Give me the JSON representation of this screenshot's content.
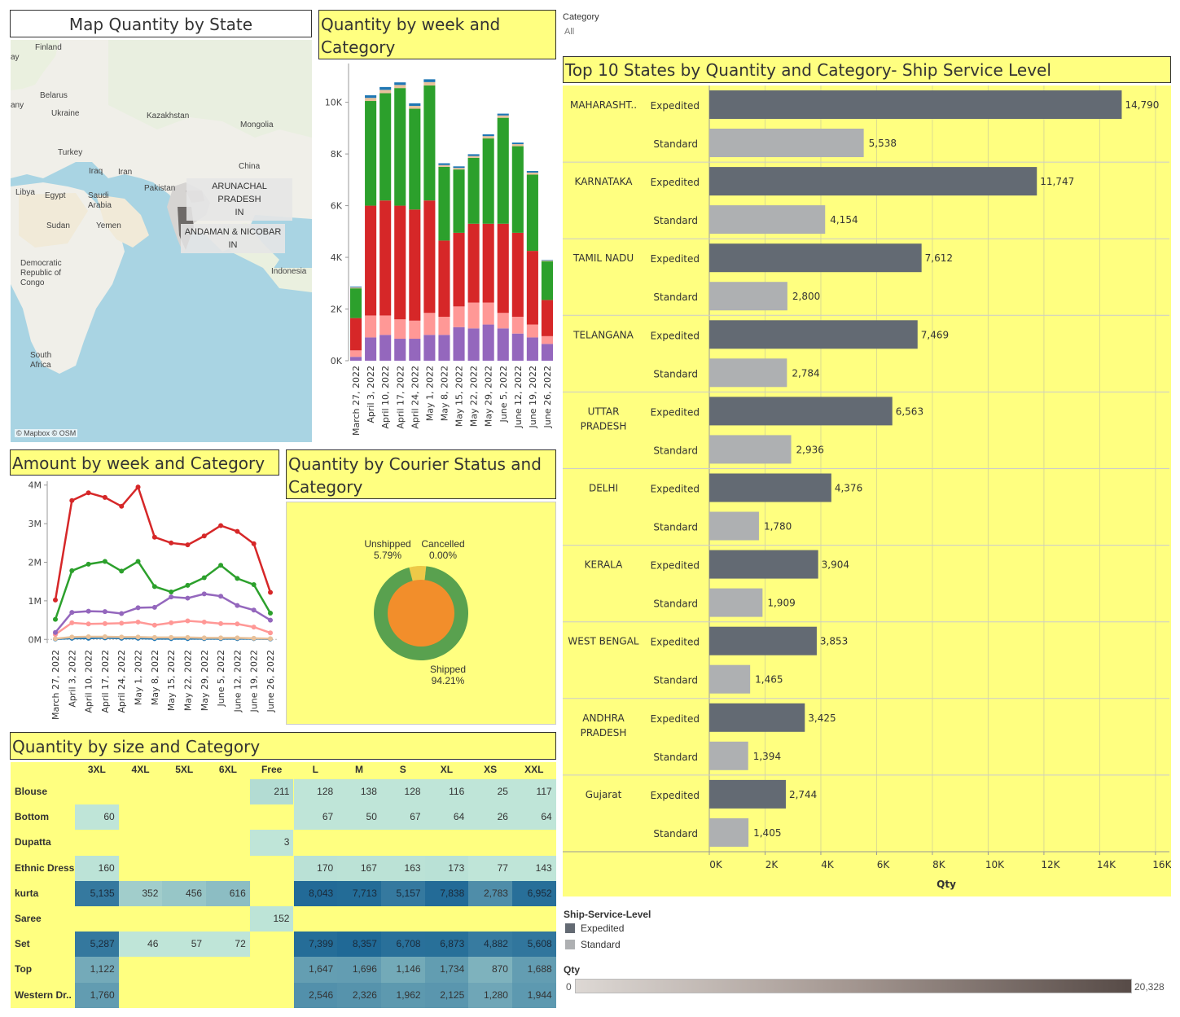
{
  "filter": {
    "label": "Category",
    "value": "All"
  },
  "map": {
    "title": "Map Quantity by State",
    "attribution": "© Mapbox © OSM",
    "labels": [
      "Finland",
      "Belarus",
      "Ukraine",
      "Kazakhstan",
      "Mongolia",
      "Turkey",
      "Iraq",
      "Iran",
      "China",
      "Libya",
      "Egypt",
      "Saudi Arabia",
      "Pakistan",
      "Sudan",
      "Yemen",
      "Indonesia",
      "Democratic Republic of Congo",
      "South Africa",
      "ay",
      "any"
    ],
    "tooltips": [
      {
        "line1": "ARUNACHAL PRADESH",
        "line2": "IN"
      },
      {
        "line1": "ANDAMAN & NICOBAR",
        "line2": "IN"
      }
    ]
  },
  "week_chart": {
    "title": "Quantity by week and Category",
    "weeks": [
      "March 27, 2022",
      "April 3, 2022",
      "April 10, 2022",
      "April 17, 2022",
      "April 24, 2022",
      "May 1, 2022",
      "May 8, 2022",
      "May 15, 2022",
      "May 22, 2022",
      "May 29, 2022",
      "June 5, 2022",
      "June 12, 2022",
      "June 19, 2022",
      "June 26, 2022"
    ],
    "y_ticks": [
      "0K",
      "2K",
      "4K",
      "6K",
      "8K",
      "10K"
    ]
  },
  "amount_chart": {
    "title": "Amount by week and Category",
    "y_ticks": [
      "0M",
      "1M",
      "2M",
      "3M",
      "4M"
    ]
  },
  "courier_chart": {
    "title": "Quantity by Courier Status and Category",
    "slices": [
      {
        "label": "Shipped",
        "pct": "94.21%",
        "value": 94.21,
        "color": "#59a14f"
      },
      {
        "label": "Unshipped",
        "pct": "5.79%",
        "value": 5.79,
        "color": "#edc948"
      },
      {
        "label": "Cancelled",
        "pct": "0.00%",
        "value": 0.0,
        "color": "#e15759"
      }
    ]
  },
  "size_table": {
    "title": "Quantity by size and Category",
    "columns": [
      "3XL",
      "4XL",
      "5XL",
      "6XL",
      "Free",
      "L",
      "M",
      "S",
      "XL",
      "XS",
      "XXL"
    ],
    "rows": [
      {
        "name": "Blouse",
        "cells": [
          "",
          "",
          "",
          "",
          "211",
          "128",
          "138",
          "128",
          "116",
          "25",
          "117"
        ]
      },
      {
        "name": "Bottom",
        "cells": [
          "60",
          "",
          "",
          "",
          "",
          "67",
          "50",
          "67",
          "64",
          "26",
          "64"
        ]
      },
      {
        "name": "Dupatta",
        "cells": [
          "",
          "",
          "",
          "",
          "3",
          "",
          "",
          "",
          "",
          "",
          ""
        ]
      },
      {
        "name": "Ethnic Dress",
        "cells": [
          "160",
          "",
          "",
          "",
          "",
          "170",
          "167",
          "163",
          "173",
          "77",
          "143"
        ]
      },
      {
        "name": "kurta",
        "cells": [
          "5,135",
          "352",
          "456",
          "616",
          "",
          "8,043",
          "7,713",
          "5,157",
          "7,838",
          "2,783",
          "6,952"
        ]
      },
      {
        "name": "Saree",
        "cells": [
          "",
          "",
          "",
          "",
          "152",
          "",
          "",
          "",
          "",
          "",
          ""
        ]
      },
      {
        "name": "Set",
        "cells": [
          "5,287",
          "46",
          "57",
          "72",
          "",
          "7,399",
          "8,357",
          "6,708",
          "6,873",
          "4,882",
          "5,608"
        ]
      },
      {
        "name": "Top",
        "cells": [
          "1,122",
          "",
          "",
          "",
          "",
          "1,647",
          "1,696",
          "1,146",
          "1,734",
          "870",
          "1,688"
        ]
      },
      {
        "name": "Western Dr..",
        "cells": [
          "1,760",
          "",
          "",
          "",
          "",
          "2,546",
          "2,326",
          "1,962",
          "2,125",
          "1,280",
          "1,944"
        ]
      }
    ]
  },
  "top_states": {
    "title": "Top 10 States by Quantity and Category- Ship Service Level",
    "x_label": "Qty",
    "x_ticks": [
      "0K",
      "2K",
      "4K",
      "6K",
      "8K",
      "10K",
      "12K",
      "14K",
      "16K"
    ],
    "states": [
      {
        "name": "MAHARASHT..",
        "expedited": 14790,
        "standard": 5538,
        "exp_label": "14,790",
        "std_label": "5,538"
      },
      {
        "name": "KARNATAKA",
        "expedited": 11747,
        "standard": 4154,
        "exp_label": "11,747",
        "std_label": "4,154"
      },
      {
        "name": "TAMIL NADU",
        "expedited": 7612,
        "standard": 2800,
        "exp_label": "7,612",
        "std_label": "2,800"
      },
      {
        "name": "TELANGANA",
        "expedited": 7469,
        "standard": 2784,
        "exp_label": "7,469",
        "std_label": "2,784"
      },
      {
        "name": "UTTAR PRADESH",
        "expedited": 6563,
        "standard": 2936,
        "exp_label": "6,563",
        "std_label": "2,936"
      },
      {
        "name": "DELHI",
        "expedited": 4376,
        "standard": 1780,
        "exp_label": "4,376",
        "std_label": "1,780"
      },
      {
        "name": "KERALA",
        "expedited": 3904,
        "standard": 1909,
        "exp_label": "3,904",
        "std_label": "1,909"
      },
      {
        "name": "WEST BENGAL",
        "expedited": 3853,
        "standard": 1465,
        "exp_label": "3,853",
        "std_label": "1,465"
      },
      {
        "name": "ANDHRA PRADESH",
        "expedited": 3425,
        "standard": 1394,
        "exp_label": "3,425",
        "std_label": "1,394"
      },
      {
        "name": "Gujarat",
        "expedited": 2744,
        "standard": 1405,
        "exp_label": "2,744",
        "std_label": "1,405"
      }
    ],
    "level_labels": {
      "expedited": "Expedited",
      "standard": "Standard"
    }
  },
  "legend": {
    "title": "Ship-Service-Level",
    "items": [
      {
        "label": "Expedited",
        "color": "#636a73"
      },
      {
        "label": "Standard",
        "color": "#aeb0b2"
      }
    ],
    "qty_title": "Qty",
    "qty_min": "0",
    "qty_max": "20,328"
  },
  "chart_data": [
    {
      "type": "bar",
      "stacked": true,
      "title": "Quantity by week and Category",
      "categories": [
        "March 27, 2022",
        "April 3, 2022",
        "April 10, 2022",
        "April 17, 2022",
        "April 24, 2022",
        "May 1, 2022",
        "May 8, 2022",
        "May 15, 2022",
        "May 22, 2022",
        "May 29, 2022",
        "June 5, 2022",
        "June 12, 2022",
        "June 19, 2022",
        "June 26, 2022"
      ],
      "ylim": [
        0,
        11500
      ],
      "series": [
        {
          "color": "#9467bd",
          "values": [
            150,
            900,
            1000,
            850,
            850,
            1000,
            1000,
            1300,
            1250,
            1400,
            1250,
            1050,
            900,
            650
          ]
        },
        {
          "color": "#ff9896",
          "values": [
            250,
            850,
            750,
            750,
            700,
            850,
            700,
            800,
            1000,
            850,
            600,
            650,
            500,
            300
          ]
        },
        {
          "color": "#d62728",
          "values": [
            1250,
            4250,
            4450,
            4400,
            4300,
            4350,
            2950,
            2850,
            3050,
            3050,
            3450,
            3250,
            2850,
            1400
          ]
        },
        {
          "color": "#2ca02c",
          "values": [
            1150,
            4050,
            4150,
            4550,
            3900,
            4450,
            2850,
            2450,
            2550,
            3300,
            4100,
            3350,
            2950,
            1500
          ]
        },
        {
          "color": "#e8c19a",
          "values": [
            40,
            120,
            130,
            120,
            110,
            130,
            70,
            60,
            70,
            90,
            90,
            80,
            80,
            30
          ]
        },
        {
          "color": "#1f77b4",
          "values": [
            30,
            100,
            110,
            100,
            100,
            110,
            70,
            60,
            70,
            70,
            70,
            60,
            60,
            20
          ]
        }
      ]
    },
    {
      "type": "line",
      "title": "Amount by week and Category",
      "categories": [
        "March 27, 2022",
        "April 3, 2022",
        "April 10, 2022",
        "April 17, 2022",
        "April 24, 2022",
        "May 1, 2022",
        "May 8, 2022",
        "May 15, 2022",
        "May 22, 2022",
        "May 29, 2022",
        "June 5, 2022",
        "June 12, 2022",
        "June 19, 2022",
        "June 26, 2022"
      ],
      "ylim": [
        -0.1,
        4.1
      ],
      "y_unit": "M",
      "series": [
        {
          "color": "#d62728",
          "values": [
            1.02,
            3.6,
            3.8,
            3.68,
            3.45,
            3.95,
            2.65,
            2.5,
            2.45,
            2.68,
            2.95,
            2.8,
            2.48,
            1.22
          ]
        },
        {
          "color": "#2ca02c",
          "values": [
            0.52,
            1.78,
            1.95,
            2.02,
            1.77,
            2.02,
            1.37,
            1.23,
            1.4,
            1.6,
            1.92,
            1.58,
            1.42,
            0.68
          ]
        },
        {
          "color": "#9467bd",
          "values": [
            0.18,
            0.7,
            0.73,
            0.72,
            0.67,
            0.82,
            0.83,
            1.1,
            1.07,
            1.18,
            1.12,
            0.88,
            0.76,
            0.5
          ]
        },
        {
          "color": "#ff9896",
          "values": [
            0.13,
            0.43,
            0.4,
            0.41,
            0.42,
            0.45,
            0.37,
            0.43,
            0.48,
            0.45,
            0.41,
            0.4,
            0.32,
            0.17
          ]
        },
        {
          "color": "#e8c19a",
          "values": [
            0.02,
            0.06,
            0.07,
            0.07,
            0.06,
            0.06,
            0.05,
            0.05,
            0.05,
            0.04,
            0.04,
            0.04,
            0.03,
            0.02
          ]
        },
        {
          "color": "#1f77b4",
          "values": [
            0.01,
            0.03,
            0.03,
            0.04,
            0.03,
            0.03,
            0.02,
            0.02,
            0.02,
            0.02,
            0.02,
            0.02,
            0.02,
            0.01
          ]
        }
      ]
    },
    {
      "type": "pie",
      "title": "Quantity by Courier Status and Category",
      "labels": [
        "Shipped",
        "Unshipped",
        "Cancelled"
      ],
      "values": [
        94.21,
        5.79,
        0.0
      ]
    },
    {
      "type": "bar",
      "orientation": "horizontal",
      "title": "Top 10 States by Quantity and Category- Ship Service Level",
      "categories": [
        "MAHARASHT..",
        "KARNATAKA",
        "TAMIL NADU",
        "TELANGANA",
        "UTTAR PRADESH",
        "DELHI",
        "KERALA",
        "WEST BENGAL",
        "ANDHRA PRADESH",
        "Gujarat"
      ],
      "xlabel": "Qty",
      "xlim": [
        0,
        16500
      ],
      "series": [
        {
          "name": "Expedited",
          "values": [
            14790,
            11747,
            7612,
            7469,
            6563,
            4376,
            3904,
            3853,
            3425,
            2744
          ]
        },
        {
          "name": "Standard",
          "values": [
            5538,
            4154,
            2800,
            2784,
            2936,
            1780,
            1909,
            1465,
            1394,
            1405
          ]
        }
      ]
    },
    {
      "type": "heatmap",
      "title": "Quantity by size and Category",
      "x": [
        "3XL",
        "4XL",
        "5XL",
        "6XL",
        "Free",
        "L",
        "M",
        "S",
        "XL",
        "XS",
        "XXL"
      ],
      "y": [
        "Blouse",
        "Bottom",
        "Dupatta",
        "Ethnic Dress",
        "kurta",
        "Saree",
        "Set",
        "Top",
        "Western Dr.."
      ],
      "values": [
        [
          null,
          null,
          null,
          null,
          211,
          128,
          138,
          128,
          116,
          25,
          117
        ],
        [
          60,
          null,
          null,
          null,
          null,
          67,
          50,
          67,
          64,
          26,
          64
        ],
        [
          null,
          null,
          null,
          null,
          3,
          null,
          null,
          null,
          null,
          null,
          null
        ],
        [
          160,
          null,
          null,
          null,
          null,
          170,
          167,
          163,
          173,
          77,
          143
        ],
        [
          5135,
          352,
          456,
          616,
          null,
          8043,
          7713,
          5157,
          7838,
          2783,
          6952
        ],
        [
          null,
          null,
          null,
          null,
          152,
          null,
          null,
          null,
          null,
          null,
          null
        ],
        [
          5287,
          46,
          57,
          72,
          null,
          7399,
          8357,
          6708,
          6873,
          4882,
          5608
        ],
        [
          1122,
          null,
          null,
          null,
          null,
          1647,
          1696,
          1146,
          1734,
          870,
          1688
        ],
        [
          1760,
          null,
          null,
          null,
          null,
          2546,
          2326,
          1962,
          2125,
          1280,
          1944
        ]
      ]
    }
  ]
}
